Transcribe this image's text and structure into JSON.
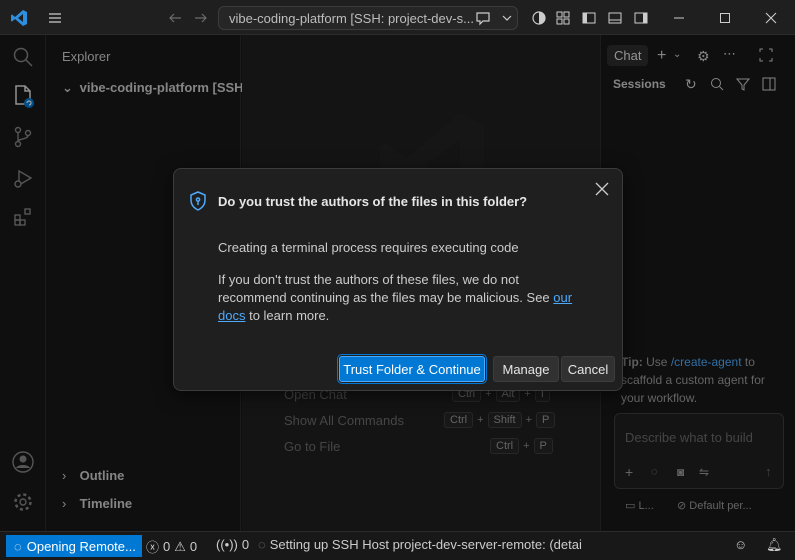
{
  "titlebar": {
    "command_center": "vibe-coding-platform [SSH: project-dev-s..."
  },
  "sidebar": {
    "title": "Explorer",
    "folder": "vibe-coding-platform [SSH...",
    "outline": "Outline",
    "timeline": "Timeline"
  },
  "welcome": {
    "items": [
      {
        "label": "Open Chat",
        "keys": [
          "Ctrl",
          "Alt",
          "I"
        ]
      },
      {
        "label": "Show All Commands",
        "keys": [
          "Ctrl",
          "Shift",
          "P"
        ]
      },
      {
        "label": "Go to File",
        "keys": [
          "Ctrl",
          "P"
        ]
      }
    ],
    "key_sep": "+"
  },
  "chat": {
    "tab": "Chat",
    "sessions_label": "Sessions",
    "tip_prefix": "Tip:",
    "tip_use": "Use",
    "tip_command": "/create-agent",
    "tip_to": "to",
    "tip_rest": "scaffold a custom agent for your workflow.",
    "input_placeholder": "Describe what to build",
    "footer_left": "L...",
    "footer_right": "Default per..."
  },
  "dialog": {
    "title": "Do you trust the authors of the files in this folder?",
    "message": "Creating a terminal process requires executing code",
    "detail_before": "If you don't trust the authors of these files, we do not recommend continuing as the files may be malicious. See",
    "detail_link": "our docs",
    "detail_after": "to learn more.",
    "buttons": {
      "trust": "Trust Folder & Continue",
      "manage": "Manage",
      "cancel": "Cancel"
    }
  },
  "statusbar": {
    "remote": "Opening Remote...",
    "errors": "0",
    "warnings": "0",
    "ports": "0",
    "message": "Setting up SSH Host project-dev-server-remote: (detai"
  },
  "colors": {
    "accent": "#0078d4",
    "link": "#4daafc",
    "background": "#181818"
  }
}
